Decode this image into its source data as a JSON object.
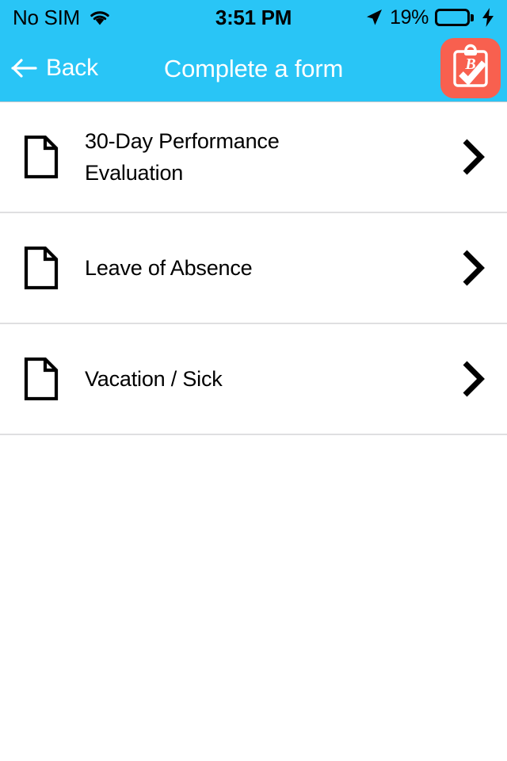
{
  "status_bar": {
    "carrier": "No SIM",
    "wifi_icon": "wifi-icon",
    "time": "3:51 PM",
    "location_icon": "location-arrow-icon",
    "battery_percent": "19%",
    "battery_level": 19,
    "battery_fill_color": "#FF3B30",
    "charging_icon": "lightning-bolt-icon",
    "background_color": "#29C5F6"
  },
  "nav_bar": {
    "back_icon": "arrow-left-icon",
    "back_label": "Back",
    "title": "Complete a form",
    "app_logo_icon": "clipboard-check-icon",
    "app_logo_color": "#F8604F",
    "background_color": "#29C5F6",
    "text_color": "#FFFFFF"
  },
  "form_list": {
    "divider_color": "#DFDFE1",
    "items": [
      {
        "icon": "document-icon",
        "label": "30-Day Performance\nEvaluation",
        "chevron": "chevron-right-icon"
      },
      {
        "icon": "document-icon",
        "label": "Leave of Absence",
        "chevron": "chevron-right-icon"
      },
      {
        "icon": "document-icon",
        "label": "Vacation / Sick",
        "chevron": "chevron-right-icon"
      }
    ]
  }
}
